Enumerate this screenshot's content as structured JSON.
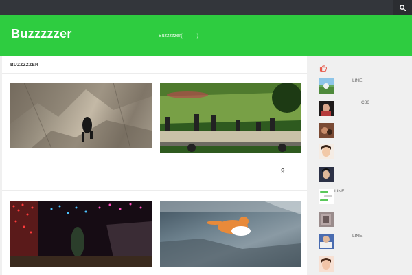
{
  "site": {
    "title": "Buzzzzzer",
    "tagline": "Buzzzzzer(　　　)"
  },
  "main": {
    "section_title": "BUZZZZZER",
    "count_label": "9"
  },
  "sidebar": {
    "items": [
      {
        "label": "LINE"
      },
      {
        "label": "C86"
      },
      {
        "label": ""
      },
      {
        "label": ""
      },
      {
        "label": ""
      },
      {
        "label": "LINE"
      },
      {
        "label": ""
      },
      {
        "label": "LINE"
      },
      {
        "label": ""
      }
    ]
  },
  "colors": {
    "accent": "#2ecc40",
    "topbar": "#33363b",
    "thumbs_up": "#e8594a"
  },
  "icons": {
    "search": "search-icon",
    "thumbs_up": "thumbs-up-icon"
  }
}
